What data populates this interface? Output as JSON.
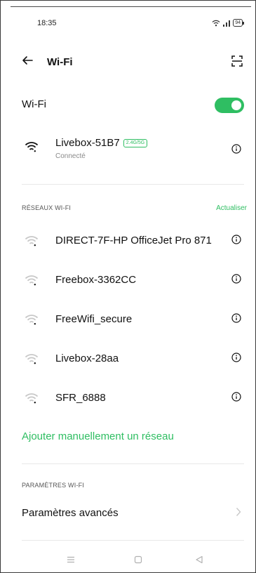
{
  "status_bar": {
    "time": "18:35",
    "battery": "94"
  },
  "header": {
    "title": "Wi-Fi"
  },
  "wifi_toggle": {
    "label": "Wi-Fi",
    "state": "on"
  },
  "connected_network": {
    "name": "Livebox-51B7",
    "band_badge": "2.4G/5G",
    "status": "Connecté"
  },
  "networks_section": {
    "label": "RÉSEAUX WI-FI",
    "refresh_label": "Actualiser",
    "items": [
      {
        "name": "DIRECT-7F-HP OfficeJet Pro 871"
      },
      {
        "name": "Freebox-3362CC"
      },
      {
        "name": "FreeWifi_secure"
      },
      {
        "name": "Livebox-28aa"
      },
      {
        "name": "SFR_6888"
      }
    ]
  },
  "add_network_label": "Ajouter manuellement un réseau",
  "settings_section": {
    "label": "PARAMÈTRES WI-FI",
    "advanced_label": "Paramètres avancés"
  },
  "colors": {
    "accent": "#2fbe62",
    "text": "#111111",
    "secondary_text": "#8a8a8a"
  },
  "icons": [
    "back-arrow-icon",
    "qr-scan-icon",
    "wifi-icon",
    "info-icon",
    "chevron-right-icon",
    "menu-icon",
    "home-icon",
    "back-triangle-icon"
  ]
}
